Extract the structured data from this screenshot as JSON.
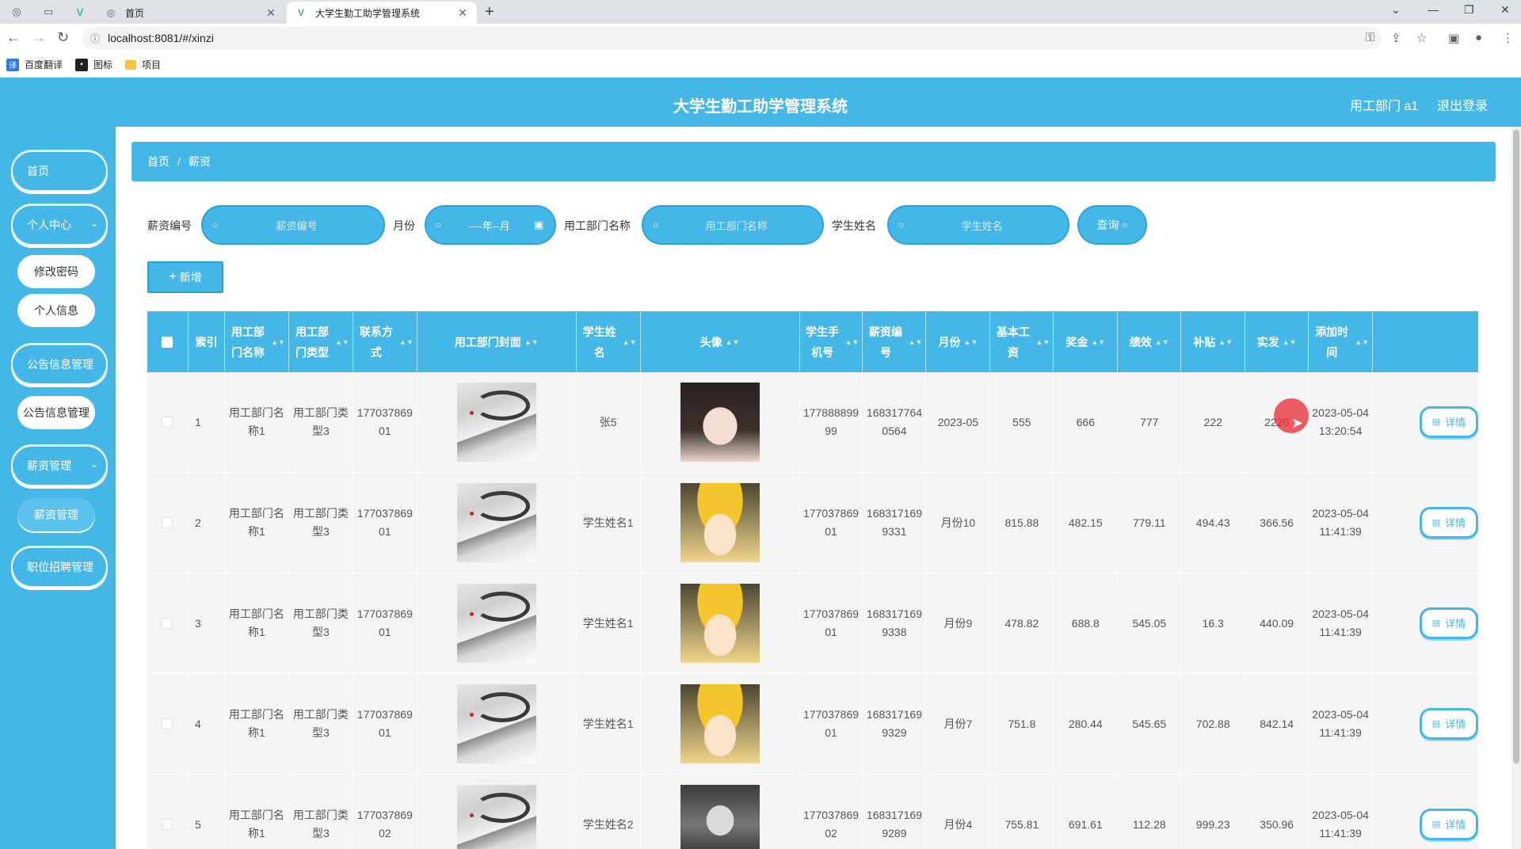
{
  "browser": {
    "tabs": [
      {
        "title": "首页",
        "icon": "globe-icon"
      },
      {
        "title": "大学生勤工助学管理系统",
        "icon": "vue-icon"
      }
    ],
    "url": "localhost:8081/#/xinzi",
    "bookmarks": [
      {
        "label": "百度翻译"
      },
      {
        "label": "图标"
      },
      {
        "label": "项目"
      }
    ]
  },
  "header": {
    "title": "大学生勤工助学管理系统",
    "user": "用工部门 a1",
    "logout": "退出登录"
  },
  "sidebar": {
    "items": [
      {
        "label": "首页"
      },
      {
        "label": "个人中心"
      },
      {
        "label": "修改密码"
      },
      {
        "label": "个人信息"
      },
      {
        "label": "公告信息管理"
      },
      {
        "label": "公告信息管理"
      },
      {
        "label": "薪资管理"
      },
      {
        "label": "薪资管理"
      },
      {
        "label": "职位招聘管理"
      }
    ]
  },
  "breadcrumb": {
    "home": "首页",
    "current": "薪资"
  },
  "filters": {
    "salary_no_label": "薪资编号",
    "salary_no_placeholder": "薪资编号",
    "month_label": "月份",
    "month_placeholder": "----年--月",
    "dept_label": "用工部门名称",
    "dept_placeholder": "用工部门名称",
    "student_label": "学生姓名",
    "student_placeholder": "学生姓名",
    "query_button": "查询"
  },
  "actions": {
    "add_button": "新增"
  },
  "table": {
    "headers": {
      "index": "索引",
      "dept_name": "用工部门名称",
      "dept_type": "用工部门类型",
      "contact": "联系方式",
      "dept_cover": "用工部门封面",
      "student_name": "学生姓名",
      "avatar": "头像",
      "student_phone": "学生手机号",
      "salary_no": "薪资编号",
      "month": "月份",
      "base_salary": "基本工资",
      "bonus": "奖金",
      "performance": "绩效",
      "subsidy": "补贴",
      "actual": "实发",
      "added_time": "添加时间"
    },
    "detail_label": "详情",
    "rows": [
      {
        "index": "1",
        "dept_name": "用工部门名称1",
        "dept_type": "用工部门类型3",
        "contact": "17703786901",
        "student_name": "张5",
        "avatar": "girl",
        "student_phone": "17788889999",
        "salary_no": "1683177640564",
        "month": "2023-05",
        "base_salary": "555",
        "bonus": "666",
        "performance": "777",
        "subsidy": "222",
        "actual": "2220",
        "added_time": "2023-05-04 13:20:54"
      },
      {
        "index": "2",
        "dept_name": "用工部门名称1",
        "dept_type": "用工部门类型3",
        "contact": "17703786901",
        "student_name": "学生姓名1",
        "avatar": "conan",
        "student_phone": "17703786901",
        "salary_no": "1683171699331",
        "month": "月份10",
        "base_salary": "815.88",
        "bonus": "482.15",
        "performance": "779.11",
        "subsidy": "494.43",
        "actual": "366.56",
        "added_time": "2023-05-04 11:41:39"
      },
      {
        "index": "3",
        "dept_name": "用工部门名称1",
        "dept_type": "用工部门类型3",
        "contact": "17703786901",
        "student_name": "学生姓名1",
        "avatar": "conan",
        "student_phone": "17703786901",
        "salary_no": "1683171699338",
        "month": "月份9",
        "base_salary": "478.82",
        "bonus": "688.8",
        "performance": "545.05",
        "subsidy": "16.3",
        "actual": "440.09",
        "added_time": "2023-05-04 11:41:39"
      },
      {
        "index": "4",
        "dept_name": "用工部门名称1",
        "dept_type": "用工部门类型3",
        "contact": "17703786901",
        "student_name": "学生姓名1",
        "avatar": "conan",
        "student_phone": "17703786901",
        "salary_no": "1683171699329",
        "month": "月份7",
        "base_salary": "751.8",
        "bonus": "280.44",
        "performance": "545.65",
        "subsidy": "702.88",
        "actual": "842.14",
        "added_time": "2023-05-04 11:41:39"
      },
      {
        "index": "5",
        "dept_name": "用工部门名称1",
        "dept_type": "用工部门类型3",
        "contact": "17703786902",
        "student_name": "学生姓名2",
        "avatar": "boy",
        "student_phone": "17703786902",
        "salary_no": "1683171699289",
        "month": "月份4",
        "base_salary": "755.81",
        "bonus": "691.61",
        "performance": "112.28",
        "subsidy": "999.23",
        "actual": "350.96",
        "added_time": "2023-05-04 11:41:39"
      }
    ]
  },
  "colors": {
    "accent": "#45b7e6",
    "accent_border": "#2aa3d6"
  }
}
